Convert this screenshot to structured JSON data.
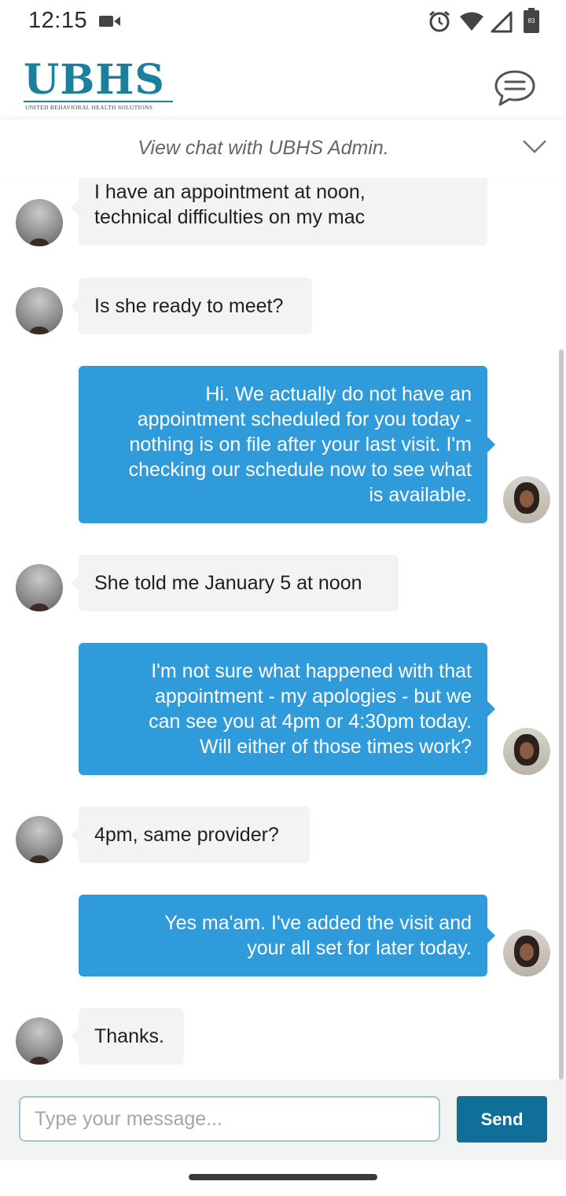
{
  "status_bar": {
    "time": "12:15",
    "battery_level": "83",
    "icons": [
      "video-camera-icon",
      "alarm-icon",
      "wifi-icon",
      "signal-icon",
      "battery-icon"
    ]
  },
  "header": {
    "logo_text": "UBHS",
    "logo_subtitle": "UNITED BEHAVIORAL HEALTH SOLUTIONS",
    "chat_icon": "chat-bubble-icon"
  },
  "chat": {
    "title": "View chat with UBHS Admin.",
    "collapse_icon": "chevron-down-icon",
    "messages": [
      {
        "from": "user",
        "lines": [
          "I have an appointment at noon,",
          "technical difficulties on my mac"
        ]
      },
      {
        "from": "user",
        "lines": [
          "Is she ready to meet?"
        ]
      },
      {
        "from": "admin",
        "lines": [
          "Hi. We actually do not have an",
          "appointment scheduled for you today -",
          "nothing is on file after your last visit. I'm",
          "checking our schedule now to see what",
          "is available."
        ]
      },
      {
        "from": "user",
        "lines": [
          "She told me January 5 at noon"
        ]
      },
      {
        "from": "admin",
        "lines": [
          "I'm not sure what happened with that",
          "appointment - my apologies - but we",
          "can see you at 4pm or 4:30pm today.",
          "Will either of those times work?"
        ]
      },
      {
        "from": "user",
        "lines": [
          "4pm, same provider?"
        ]
      },
      {
        "from": "admin",
        "lines": [
          "Yes ma'am. I've added the visit and",
          "your all set for later today."
        ]
      },
      {
        "from": "user",
        "lines": [
          "Thanks."
        ]
      }
    ]
  },
  "composer": {
    "placeholder": "Type your message...",
    "value": "",
    "send_label": "Send"
  },
  "colors": {
    "brand": "#1b7f9e",
    "outgoing_bubble": "#2f9bdb",
    "incoming_bubble": "#f2f3f3",
    "send_button": "#0f6f98"
  }
}
